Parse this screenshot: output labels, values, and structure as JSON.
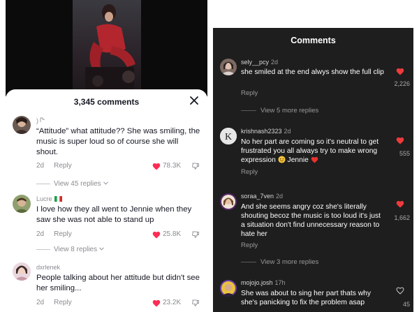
{
  "left_panel": {
    "comments_count_label": "3,345 comments",
    "comments": [
      {
        "username": ")",
        "text": "“Attitude” what attitude?? She was smiling, the music is super loud so of course she will shout.",
        "time": "2d",
        "reply_label": "Reply",
        "likes": "78.3K",
        "liked": true,
        "more_replies": "View 45 replies"
      },
      {
        "username": "Lucre",
        "text": "I love how they all went to Jennie when they saw she was not able to stand up",
        "time": "2d",
        "reply_label": "Reply",
        "likes": "25.8K",
        "liked": true,
        "more_replies": "View 8 replies"
      },
      {
        "username": "dxrlenek",
        "text": "People talking about her attitude but didn't see her smiling...",
        "time": "2d",
        "reply_label": "Reply",
        "likes": "23.2K",
        "liked": true
      }
    ]
  },
  "right_panel": {
    "title": "Comments",
    "comments": [
      {
        "username": "sely__pcy",
        "time": "2d",
        "text": "she smiled at the end alwys show the full clip",
        "reply_label": "Reply",
        "likes": "2,226",
        "liked": true,
        "more_replies": "View 5 more replies"
      },
      {
        "username": "krishnash2323",
        "time": "2d",
        "text": "No her part are coming so it's neutral to get frustrated you all always try to make wrong expression",
        "text_suffix": "Jennie",
        "reply_label": "Reply",
        "likes": "555",
        "liked": true
      },
      {
        "username": "soraa_7ven",
        "time": "2d",
        "text": "And she seems angry coz she's literally shouting becoz the music is too  loud it's just a situation don't find unnecessary reason to hate her",
        "reply_label": "Reply",
        "likes": "1,662",
        "liked": true,
        "more_replies": "View 3 more replies"
      },
      {
        "username": "mojojo.josh",
        "time": "17h",
        "text": "She was about to sing her part thats why she's panicking to fix the problem asap",
        "likes": "45",
        "liked": false
      }
    ]
  },
  "colors": {
    "heart_red": "#fe2c55",
    "right_heart_red": "#ef3b3b",
    "dark_background": "#1e1e1f"
  },
  "icons": [
    "close-icon",
    "heart-icon",
    "dislike-icon",
    "chevron-down-icon",
    "flag-icon",
    "smile-emoji-icon",
    "red-heart-emoji-icon"
  ]
}
